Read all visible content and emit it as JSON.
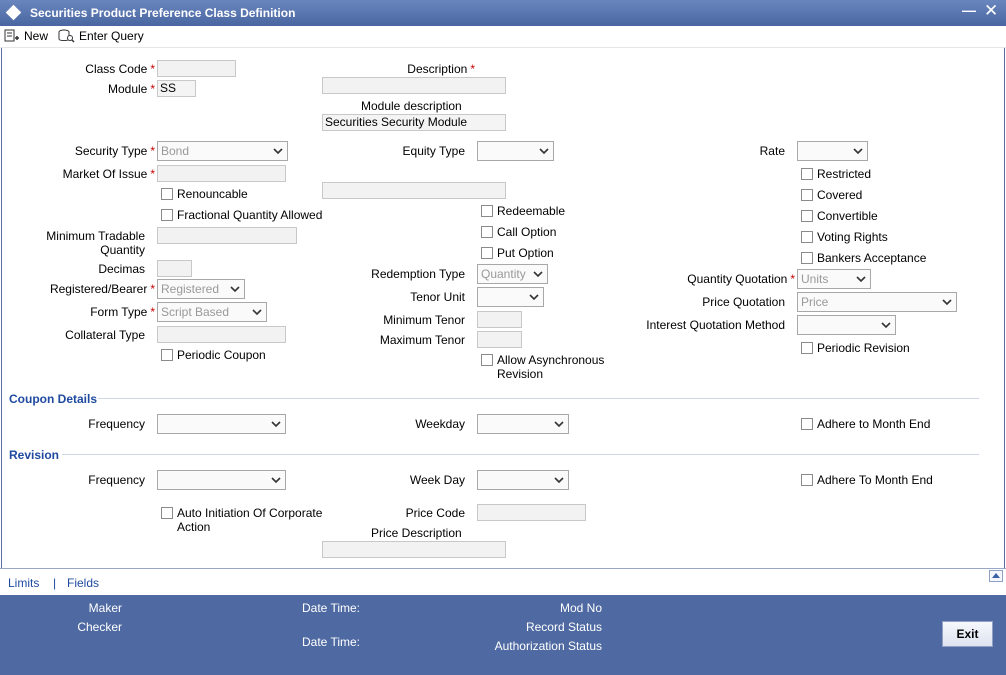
{
  "window": {
    "title": "Securities Product Preference Class Definition"
  },
  "toolbar": {
    "new_label": "New",
    "enter_query_label": "Enter Query"
  },
  "form": {
    "class_code_label": "Class Code",
    "class_code_value": "",
    "module_label": "Module",
    "module_value": "SS",
    "description_label": "Description",
    "module_description_label": "Module description",
    "module_description_value": "Securities Security Module",
    "security_type_label": "Security Type",
    "security_type_value": "Bond",
    "equity_type_label": "Equity Type",
    "rate_label": "Rate",
    "market_of_issue_label": "Market Of Issue",
    "renouncable_label": "Renouncable",
    "fractional_quantity_label": "Fractional Quantity Allowed",
    "minimum_tradable_label_1": "Minimum Tradable",
    "minimum_tradable_label_2": "Quantity",
    "decimals_label": "Decimas",
    "registered_bearer_label": "Registered/Bearer",
    "registered_bearer_value": "Registered",
    "form_type_label": "Form Type",
    "form_type_value": "Script Based",
    "collateral_type_label": "Collateral Type",
    "periodic_coupon_label": "Periodic Coupon",
    "redeemable_label": "Redeemable",
    "call_option_label": "Call Option",
    "put_option_label": "Put Option",
    "redemption_type_label": "Redemption Type",
    "redemption_type_value": "Quantity",
    "tenor_unit_label": "Tenor Unit",
    "minimum_tenor_label": "Minimum Tenor",
    "maximum_tenor_label": "Maximum Tenor",
    "allow_async_label_1": "Allow Asynchronous",
    "allow_async_label_2": "Revision",
    "restricted_label": "Restricted",
    "covered_label": "Covered",
    "convertible_label": "Convertible",
    "voting_rights_label": "Voting Rights",
    "bankers_acceptance_label": "Bankers Acceptance",
    "quantity_quotation_label": "Quantity Quotation",
    "quantity_quotation_value": "Units",
    "price_quotation_label": "Price Quotation",
    "price_quotation_value": "Price",
    "interest_quotation_label": "Interest Quotation Method",
    "periodic_revision_label": "Periodic Revision"
  },
  "coupon": {
    "section_label": "Coupon Details",
    "frequency_label": "Frequency",
    "weekday_label": "Weekday",
    "adhere_label": "Adhere to Month End"
  },
  "revision": {
    "section_label": "Revision",
    "frequency_label": "Frequency",
    "weekday_label": "Week Day",
    "adhere_label": "Adhere To Month End",
    "auto_init_label_1": "Auto Initiation Of Corporate",
    "auto_init_label_2": "Action",
    "price_code_label": "Price Code",
    "price_description_label": "Price Description"
  },
  "footer": {
    "limits_link": "Limits",
    "separator": "|",
    "fields_link": "Fields",
    "maker_label": "Maker",
    "checker_label": "Checker",
    "date_time_label_1": "Date Time:",
    "date_time_label_2": "Date Time:",
    "mod_no_label": "Mod No",
    "record_status_label": "Record Status",
    "authorization_status_label": "Authorization Status",
    "exit_label": "Exit"
  },
  "required_marker": "*"
}
